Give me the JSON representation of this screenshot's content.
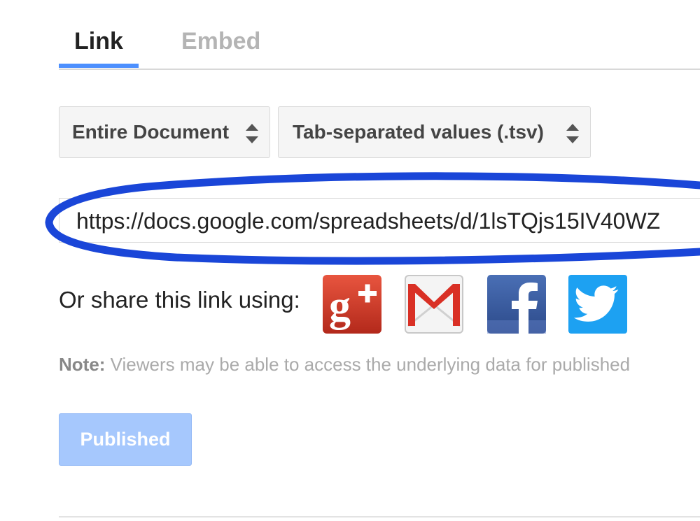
{
  "tabs": [
    {
      "label": "Link",
      "active": true
    },
    {
      "label": "Embed",
      "active": false
    }
  ],
  "selects": {
    "scope": {
      "value": "Entire Document"
    },
    "format": {
      "value": "Tab-separated values (.tsv)"
    }
  },
  "url_field": {
    "value": "https://docs.google.com/spreadsheets/d/1lsTQjs15IV40WZ"
  },
  "share": {
    "label": "Or share this link using:",
    "icons": [
      "google-plus-icon",
      "gmail-icon",
      "facebook-icon",
      "twitter-icon"
    ]
  },
  "note": {
    "label": "Note:",
    "text": " Viewers may be able to access the underlying data for published"
  },
  "published_button": {
    "label": "Published"
  },
  "colors": {
    "accent": "#4d90fe",
    "annotation": "#1a46d8",
    "published_button": "#a6c8fd"
  }
}
